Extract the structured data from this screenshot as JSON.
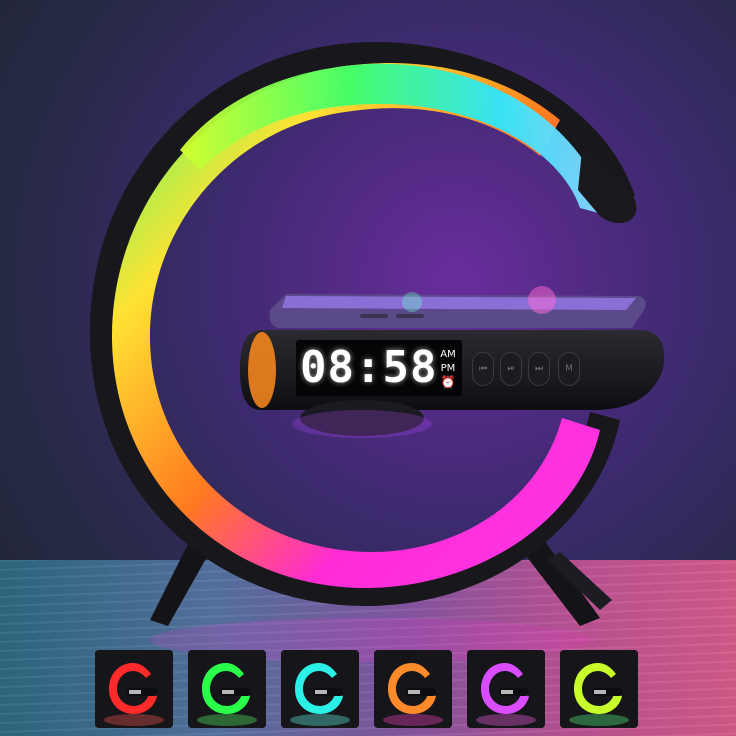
{
  "clock": {
    "time": "08:58",
    "am_label": "AM",
    "pm_label": "PM"
  },
  "controls": [
    {
      "icon": "previous-track-icon",
      "glyph": "⏮"
    },
    {
      "icon": "play-pause-icon",
      "glyph": "⏯"
    },
    {
      "icon": "next-track-icon",
      "glyph": "⏭"
    },
    {
      "icon": "mode-icon",
      "glyph": "M"
    }
  ],
  "alarm_icon": "alarm-clock-icon",
  "ring_colors": [
    "#ffe233",
    "#3dff6b",
    "#2ee6ff",
    "#b44dff",
    "#ff2bd6",
    "#ff3a2e"
  ],
  "thumbnails": [
    {
      "color": "#ff2a2a",
      "glow": "#ff5555"
    },
    {
      "color": "#2aff4a",
      "glow": "#55ff66"
    },
    {
      "color": "#2af0e6",
      "glow": "#66ffee"
    },
    {
      "color": "#ff8a2a",
      "glow": "#ff44cc"
    },
    {
      "color": "#d94dff",
      "glow": "#ff66ee"
    },
    {
      "color": "#c8ff2a",
      "glow": "#55ff88"
    }
  ]
}
